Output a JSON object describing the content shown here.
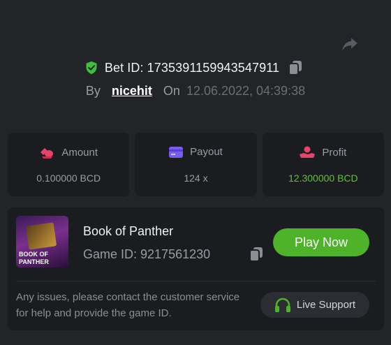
{
  "header": {
    "share_icon": "share-arrow-icon",
    "bet_id": "Bet ID: 1735391159943547911",
    "by_label": "By",
    "username": "nicehit",
    "on_label": "On",
    "timestamp": "12.06.2022, 04:39:38"
  },
  "stats": [
    {
      "label": "Amount",
      "value": "0.100000 BCD",
      "icon": "bet-chip-icon",
      "icon_color": "#e8436a"
    },
    {
      "label": "Payout",
      "value": "124 x",
      "icon": "card-icon",
      "icon_color": "#7b5cf0"
    },
    {
      "label": "Profit",
      "value": "12.300000 BCD",
      "icon": "hand-coin-icon",
      "icon_color": "#e8436a"
    }
  ],
  "game": {
    "thumbnail_title_line1": "BOOK OF",
    "thumbnail_title_line2": "PANTHER",
    "name": "Book of Panther",
    "game_id": "Game ID: 9217561230",
    "play_label": "Play Now",
    "note": "Any issues, please contact the customer service for help and provide the game ID.",
    "support_label": "Live Support"
  },
  "colors": {
    "background": "#232428",
    "card": "#1b1c20",
    "accent_green": "#4fb32a",
    "profit_green": "#5fc235",
    "shield_green": "#3fbf3f"
  }
}
